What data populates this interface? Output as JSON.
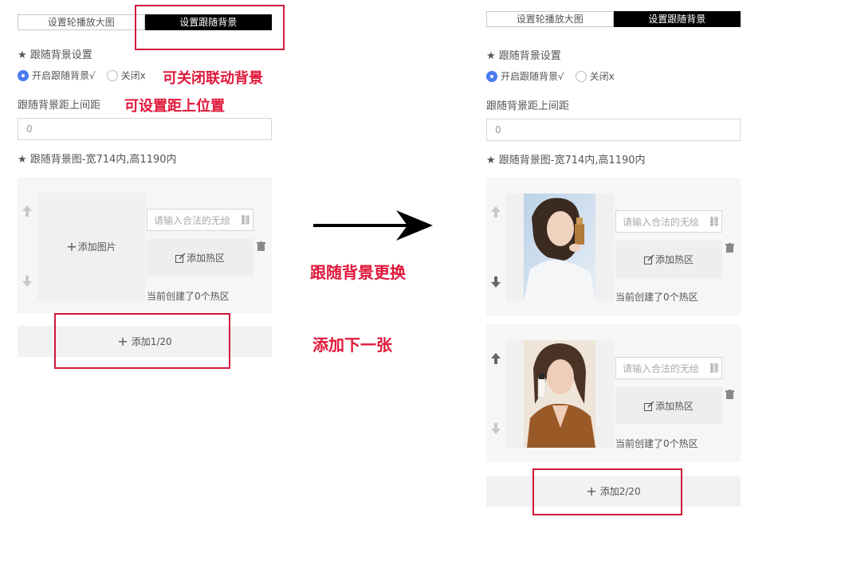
{
  "tabs": [
    "设置轮播放大图",
    "设置跟随背景"
  ],
  "follow_bg_title": "★ 跟随背景设置",
  "radio_on_label": "开启跟随背景√",
  "radio_off_label": "关闭x",
  "distance_label": "跟随背景距上间距",
  "distance_value": "0",
  "image_label": "★ 跟随背景图-宽714内,高1190内",
  "add_image_label": "添加图片",
  "url_placeholder": "请输入合法的无绘",
  "add_hotspot_label": "添加热区",
  "hotspot_count_text": "当前创建了0个热区",
  "left_add_label": "添加1/20",
  "right_add_label": "添加2/20",
  "annotations": {
    "close_link": "可关闭联动背景",
    "set_distance": "可设置距上位置",
    "bg_change": "跟随背景更换",
    "add_next": "添加下一张"
  },
  "colors": {
    "accent_red": "#e0183a",
    "radio_blue": "#4a7cf0",
    "tab_active": "#000000"
  },
  "icons": [
    "up-arrow-icon",
    "down-arrow-icon",
    "plus-icon",
    "edit-icon",
    "link-icon",
    "trash-icon",
    "right-arrow-icon"
  ]
}
